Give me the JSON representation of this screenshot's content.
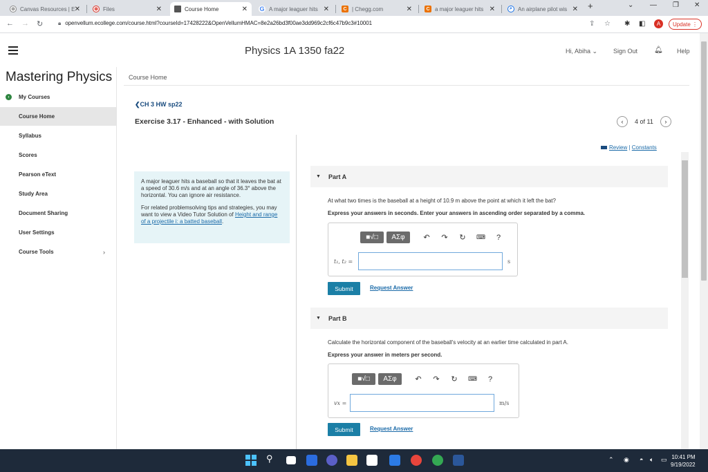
{
  "browser": {
    "tabs": [
      {
        "title": "Canvas Resources | E",
        "icon": "canvas-icon"
      },
      {
        "title": "Files",
        "icon": "files-icon"
      },
      {
        "title": "Course Home",
        "icon": "page-icon"
      },
      {
        "title": "A major leaguer hits",
        "icon": "google-icon"
      },
      {
        "title": "| Chegg.com",
        "icon": "chegg-icon"
      },
      {
        "title": "a major leaguer hits",
        "icon": "chegg-icon"
      },
      {
        "title": "An airplane pilot wis",
        "icon": "bing-icon"
      }
    ],
    "url": "openvellum.ecollege.com/course.html?courseId=17428222&OpenVellumHMAC=8e2a26bd3f00ae3dd969c2cf6c47b9c3#10001",
    "profile_initial": "A",
    "update_label": "Update"
  },
  "header": {
    "course_title": "Physics 1A 1350 fa22",
    "user": "Hi, Abiha",
    "sign_out": "Sign Out",
    "help": "Help"
  },
  "sidebar": {
    "brand": "Mastering Physics",
    "items": [
      {
        "label": "My Courses"
      },
      {
        "label": "Course Home"
      },
      {
        "label": "Syllabus"
      },
      {
        "label": "Scores"
      },
      {
        "label": "Pearson eText"
      },
      {
        "label": "Study Area"
      },
      {
        "label": "Document Sharing"
      },
      {
        "label": "User Settings"
      },
      {
        "label": "Course Tools"
      }
    ]
  },
  "main": {
    "breadcrumb": "Course Home",
    "back_link": "CH 3 HW sp22",
    "exercise_title": "Exercise 3.17 - Enhanced - with Solution",
    "pager_text": "4 of 11",
    "review": "Review",
    "separator": "|",
    "constants": "Constants",
    "info_p1": "A major leaguer hits a baseball so that it leaves the bat at a speed of 30.6 m/s and at an angle of 36.3° above the horizontal. You can ignore air resistance.",
    "info_p2_prefix": "For related problemsolving tips and strategies, you may want to view a Video Tutor Solution of ",
    "info_p2_link": "Height and range of a projectile i: a batted baseball",
    "info_p2_suffix": "."
  },
  "partA": {
    "title": "Part A",
    "question": "At what two times is the baseball at a height of 10.9 m above the point at which it left the bat?",
    "instruction": "Express your answers in seconds. Enter your answers in ascending order separated by a comma.",
    "variable": "t₁, t₂ =",
    "unit": "s",
    "answer_value": "",
    "submit": "Submit",
    "request": "Request Answer"
  },
  "partB": {
    "title": "Part B",
    "question": "Calculate the horizontal component of the baseball's velocity at an earlier time calculated in part A.",
    "instruction": "Express your answer in meters per second.",
    "variable": "vx =",
    "unit": "m/s",
    "answer_value": "",
    "submit": "Submit",
    "request": "Request Answer"
  },
  "toolbar": {
    "template_btn": "■√□",
    "greek_btn": "ΑΣφ",
    "help": "?"
  },
  "taskbar": {
    "time": "10:41 PM",
    "date": "9/19/2022"
  }
}
